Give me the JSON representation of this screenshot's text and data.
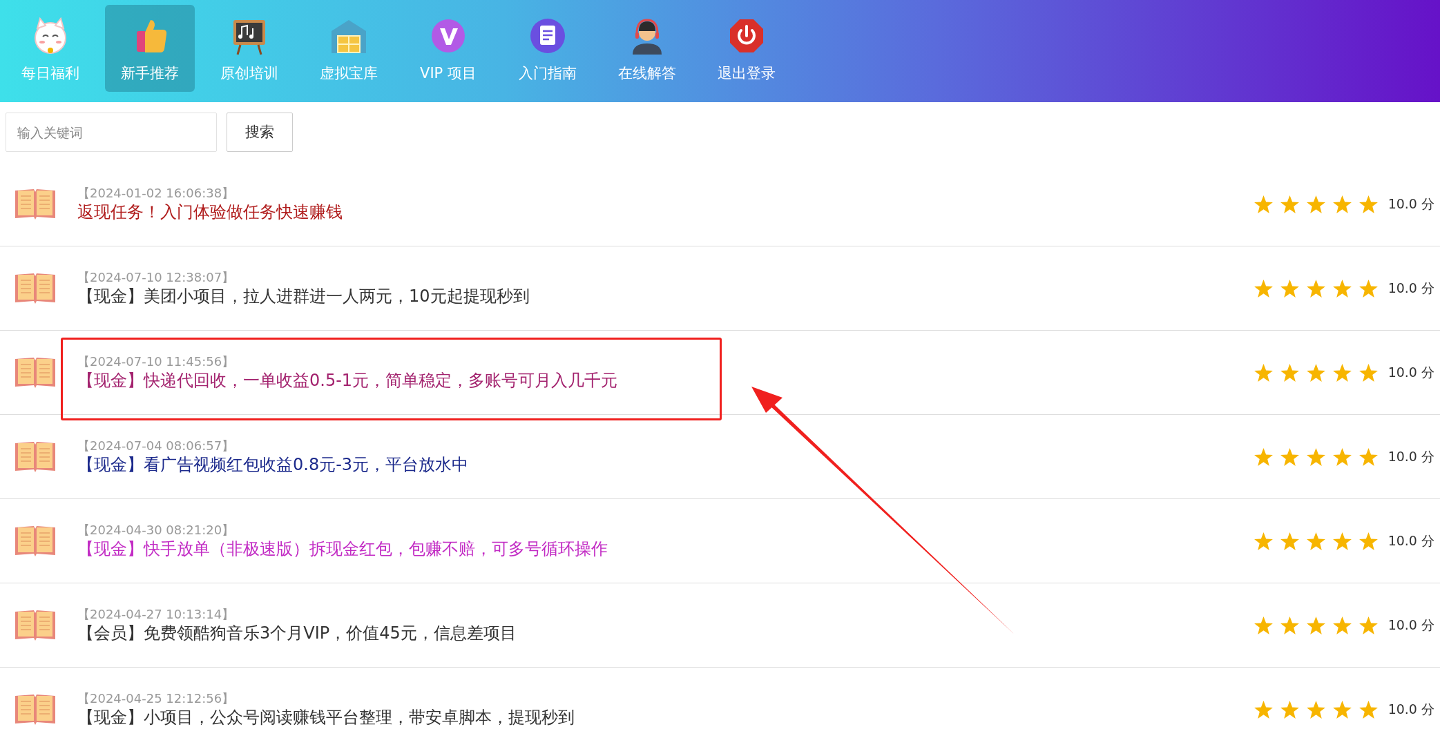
{
  "nav": [
    {
      "label": "每日福利",
      "selected": false
    },
    {
      "label": "新手推荐",
      "selected": true
    },
    {
      "label": "原创培训",
      "selected": false
    },
    {
      "label": "虚拟宝库",
      "selected": false
    },
    {
      "label": "VIP 项目",
      "selected": false
    },
    {
      "label": "入门指南",
      "selected": false
    },
    {
      "label": "在线解答",
      "selected": false
    },
    {
      "label": "退出登录",
      "selected": false
    }
  ],
  "search": {
    "placeholder": "输入关键词",
    "button": "搜索"
  },
  "articles": [
    {
      "date": "【2024-01-02 16:06:38】",
      "title": "返现任务！入门体验做任务快速赚钱",
      "color": "#b01c1c",
      "stars": 5,
      "score": "10.0 分",
      "highlighted": false
    },
    {
      "date": "【2024-07-10 12:38:07】",
      "title": "【现金】美团小项目，拉人进群进一人两元，10元起提现秒到",
      "color": "#333333",
      "stars": 5,
      "score": "10.0 分",
      "highlighted": false
    },
    {
      "date": "【2024-07-10 11:45:56】",
      "title": "【现金】快递代回收，一单收益0.5-1元，简单稳定，多账号可月入几千元",
      "color": "#a3226e",
      "stars": 5,
      "score": "10.0 分",
      "highlighted": true
    },
    {
      "date": "【2024-07-04 08:06:57】",
      "title": "【现金】看广告视频红包收益0.8元-3元，平台放水中",
      "color": "#1c2a8c",
      "stars": 5,
      "score": "10.0 分",
      "highlighted": false
    },
    {
      "date": "【2024-04-30 08:21:20】",
      "title": "【现金】快手放单（非极速版）拆现金红包，包赚不赔，可多号循环操作",
      "color": "#c22bc4",
      "stars": 5,
      "score": "10.0 分",
      "highlighted": false
    },
    {
      "date": "【2024-04-27 10:13:14】",
      "title": "【会员】免费领酷狗音乐3个月VIP，价值45元，信息差项目",
      "color": "#333333",
      "stars": 5,
      "score": "10.0 分",
      "highlighted": false
    },
    {
      "date": "【2024-04-25 12:12:56】",
      "title": "【现金】小项目，公众号阅读赚钱平台整理，带安卓脚本，提现秒到",
      "color": "#333333",
      "stars": 5,
      "score": "10.0 分",
      "highlighted": false
    }
  ]
}
